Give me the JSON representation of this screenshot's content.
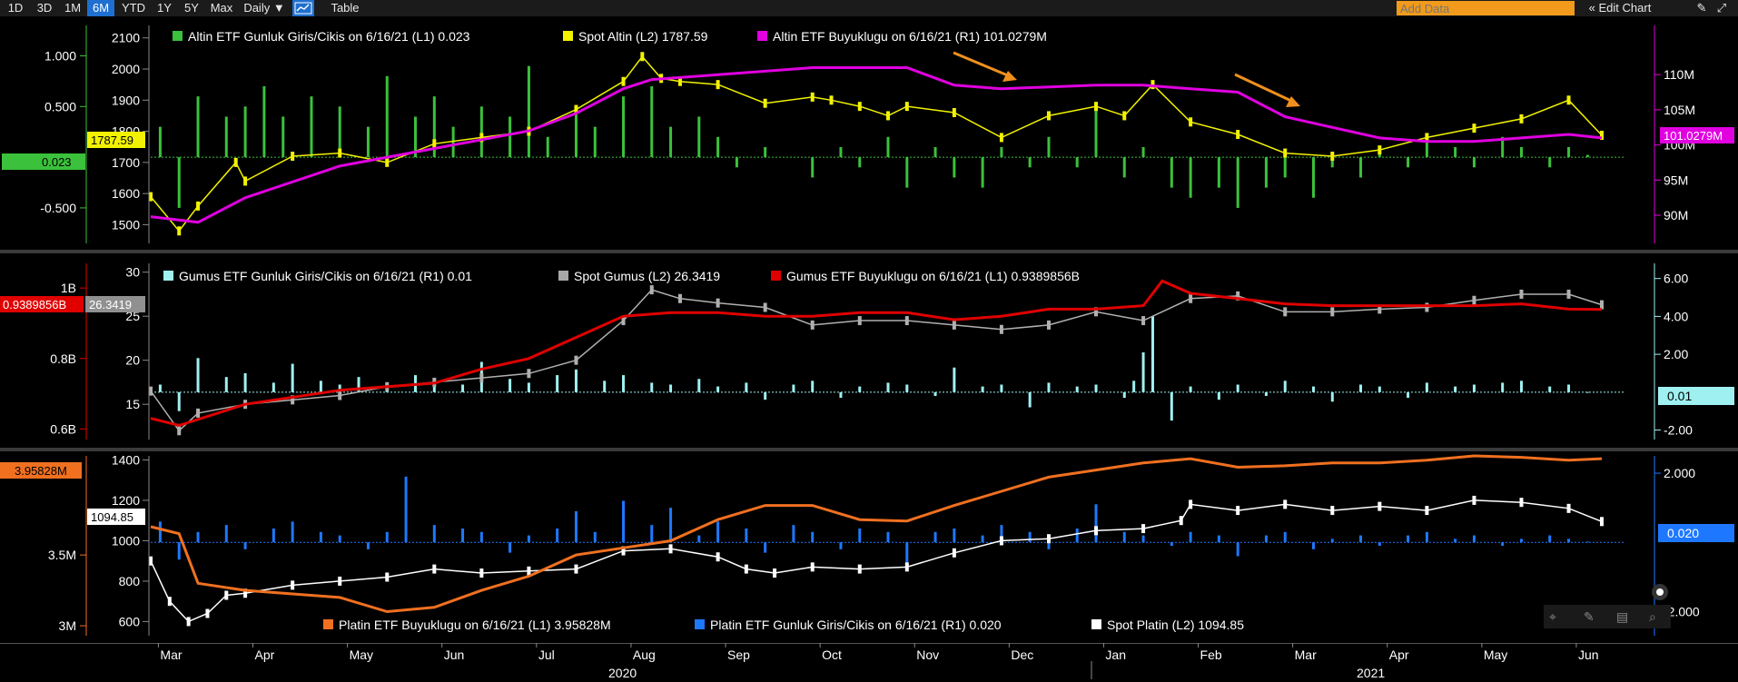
{
  "toolbar": {
    "ranges": [
      "1D",
      "3D",
      "1M",
      "6M",
      "YTD",
      "1Y",
      "5Y",
      "Max"
    ],
    "active_range": "6M",
    "frequency": "Daily ▼",
    "table_label": "Table",
    "add_data_placeholder": "Add Data",
    "edit_chart_label": "« Edit Chart"
  },
  "colors": {
    "gold_etf_flow": "#3bc13b",
    "gold_spot": "#f2f200",
    "gold_etf_size": "#e000e0",
    "silver_etf_flow": "#9ff0f0",
    "silver_spot": "#b0b0b0",
    "silver_etf_size": "#e00000",
    "plat_etf_size": "#f07020",
    "plat_etf_flow": "#1e78ff",
    "plat_spot": "#ffffff",
    "arrow": "#f0901c"
  },
  "chart_data": [
    {
      "type": "line",
      "panel": "gold",
      "legend": [
        {
          "label": "Altin ETF Gunluk Giris/Cikis on 6/16/21 (L1) 0.023",
          "color": "#3bc13b"
        },
        {
          "label": "Spot Altin (L2) 1787.59",
          "color": "#f2f200"
        },
        {
          "label": "Altin ETF Buyuklugu on 6/16/21 (R1) 101.0279M",
          "color": "#e000e0"
        }
      ],
      "left_axis_outer": {
        "ticks": [
          "1.000",
          "0.500",
          "-0.500"
        ],
        "values": [
          1,
          0.5,
          -0.5
        ],
        "ylim": [
          -0.85,
          1.3
        ]
      },
      "left_axis_inner": {
        "ticks": [
          "2100",
          "2000",
          "1900",
          "1800",
          "1700",
          "1600",
          "1500"
        ],
        "values": [
          2100,
          2000,
          1900,
          1800,
          1700,
          1600,
          1500
        ],
        "ylim": [
          1440,
          2140
        ]
      },
      "right_axis": {
        "ticks": [
          "110M",
          "105M",
          "100M",
          "95M",
          "90M"
        ],
        "values": [
          110,
          105,
          100,
          95,
          90
        ],
        "ylim": [
          86,
          117
        ]
      },
      "last_values": {
        "spot": "1787.59",
        "flow": "0.023",
        "size": "101.0279M"
      },
      "months": [
        "Mar",
        "Apr",
        "May",
        "Jun",
        "Jul",
        "Aug",
        "Sep",
        "Oct",
        "Nov",
        "Dec",
        "Jan",
        "Feb",
        "Mar",
        "Apr",
        "May",
        "Jun"
      ],
      "spot_series": {
        "name": "Spot Altin",
        "x": [
          0,
          0.3,
          0.5,
          0.9,
          1,
          1.5,
          2,
          2.5,
          3,
          3.5,
          4,
          4.5,
          5,
          5.2,
          5.4,
          5.6,
          6,
          6.5,
          7,
          7.2,
          7.5,
          7.8,
          8,
          8.5,
          9,
          9.5,
          10,
          10.3,
          10.6,
          11,
          11.5,
          12,
          12.5,
          13,
          13.5,
          14,
          14.5,
          15,
          15.35
        ],
        "values": [
          1590,
          1480,
          1560,
          1700,
          1640,
          1720,
          1730,
          1700,
          1760,
          1780,
          1800,
          1870,
          1960,
          2040,
          1970,
          1960,
          1950,
          1890,
          1910,
          1900,
          1880,
          1850,
          1880,
          1860,
          1780,
          1850,
          1880,
          1850,
          1950,
          1830,
          1790,
          1730,
          1720,
          1740,
          1780,
          1810,
          1840,
          1900,
          1787
        ]
      },
      "size_series": {
        "name": "Altin ETF Buyuklugu",
        "x": [
          0,
          0.5,
          1,
          2,
          3,
          4,
          4.5,
          5,
          5.3,
          6,
          7,
          7.5,
          8,
          8.5,
          9,
          10,
          10.5,
          11,
          11.5,
          12,
          12.5,
          13,
          13.5,
          14,
          14.5,
          15,
          15.35
        ],
        "values": [
          89.8,
          89.0,
          92.5,
          97.0,
          99.5,
          102.0,
          104.5,
          108.0,
          109.3,
          110.0,
          111.0,
          111.0,
          111.0,
          108.5,
          108.0,
          108.5,
          108.5,
          108.0,
          107.5,
          104.0,
          102.5,
          101.0,
          100.5,
          100.5,
          101.0,
          101.5,
          101.0
        ]
      },
      "flow_series": {
        "name": "Altin ETF Gunluk Giris/Cikis",
        "x": [
          0.1,
          0.3,
          0.5,
          0.8,
          1,
          1.2,
          1.4,
          1.7,
          2,
          2.3,
          2.5,
          2.8,
          3,
          3.2,
          3.5,
          3.8,
          4,
          4.2,
          4.5,
          4.7,
          5,
          5.3,
          5.5,
          5.8,
          6,
          6.2,
          6.5,
          7,
          7.3,
          7.5,
          7.8,
          8,
          8.3,
          8.5,
          8.8,
          9,
          9.3,
          9.5,
          9.8,
          10,
          10.3,
          10.5,
          10.8,
          11,
          11.3,
          11.5,
          11.8,
          12,
          12.3,
          12.5,
          12.8,
          13,
          13.3,
          13.5,
          13.8,
          14,
          14.3,
          14.5,
          14.8,
          15,
          15.2
        ],
        "values": [
          0.3,
          -0.5,
          0.6,
          0.4,
          0.5,
          0.7,
          0.4,
          0.6,
          0.5,
          0.3,
          0.8,
          0.4,
          0.6,
          0.3,
          0.5,
          0.4,
          0.9,
          0.2,
          0.5,
          0.3,
          0.6,
          0.7,
          0.3,
          0.4,
          0.2,
          -0.1,
          0.1,
          -0.2,
          0.1,
          -0.1,
          0.2,
          -0.3,
          0.1,
          -0.2,
          -0.3,
          0.1,
          -0.1,
          0.2,
          -0.1,
          0.5,
          -0.2,
          0.1,
          -0.3,
          -0.4,
          -0.3,
          -0.5,
          -0.3,
          -0.2,
          -0.4,
          -0.1,
          -0.2,
          0.1,
          -0.1,
          0.2,
          0.1,
          -0.1,
          0.2,
          0.1,
          -0.1,
          0.1,
          0.023
        ]
      }
    },
    {
      "type": "line",
      "panel": "silver",
      "legend": [
        {
          "label": "Gumus ETF Gunluk Giris/Cikis on 6/16/21 (R1) 0.01",
          "color": "#9ff0f0"
        },
        {
          "label": "Spot Gumus (L2) 26.3419",
          "color": "#a8a8a8"
        },
        {
          "label": "Gumus ETF Buyuklugu on 6/16/21 (L1) 0.9389856B",
          "color": "#e00000"
        }
      ],
      "left_axis_outer": {
        "ticks": [
          "1B",
          "0.8B",
          "0.6B"
        ],
        "values": [
          1,
          0.8,
          0.6
        ],
        "ylim": [
          0.57,
          1.07
        ]
      },
      "left_axis_inner": {
        "ticks": [
          "30",
          "25",
          "20",
          "15"
        ],
        "values": [
          30,
          25,
          20,
          15
        ],
        "ylim": [
          11,
          31
        ]
      },
      "right_axis": {
        "ticks": [
          "6.00",
          "4.00",
          "2.00",
          "-2.00"
        ],
        "values": [
          6,
          4,
          2,
          -2
        ],
        "ylim": [
          -2.5,
          6.8
        ]
      },
      "last_values": {
        "spot": "26.3419",
        "flow": "0.01",
        "size": "0.9389856B"
      },
      "spot_series": {
        "name": "Spot Gumus",
        "x": [
          0,
          0.3,
          0.5,
          1,
          1.5,
          2,
          2.5,
          3,
          3.5,
          4,
          4.5,
          5,
          5.3,
          5.6,
          6,
          6.5,
          7,
          7.5,
          8,
          8.5,
          9,
          9.5,
          10,
          10.5,
          11,
          11.5,
          12,
          12.5,
          13,
          13.5,
          14,
          14.5,
          15,
          15.35
        ],
        "values": [
          16.5,
          12,
          14,
          15,
          15.5,
          16,
          17,
          17.5,
          18,
          18.5,
          20,
          24.5,
          28,
          27,
          26.5,
          26,
          24,
          24.5,
          24.5,
          24,
          23.5,
          24,
          25.5,
          24.5,
          27,
          27.3,
          25.5,
          25.5,
          25.8,
          26,
          26.8,
          27.5,
          27.5,
          26.3
        ]
      },
      "size_series": {
        "name": "Gumus ETF Buyuklugu",
        "x": [
          0,
          0.3,
          1,
          2,
          3,
          3.5,
          4,
          4.5,
          5,
          5.5,
          6,
          6.5,
          7,
          7.5,
          8,
          8.5,
          9,
          9.5,
          10,
          10.5,
          10.7,
          11,
          11.5,
          12,
          12.5,
          13,
          13.5,
          14,
          14.5,
          15,
          15.35
        ],
        "values": [
          0.63,
          0.61,
          0.67,
          0.71,
          0.73,
          0.77,
          0.8,
          0.86,
          0.92,
          0.93,
          0.93,
          0.92,
          0.92,
          0.93,
          0.93,
          0.91,
          0.92,
          0.94,
          0.94,
          0.95,
          1.02,
          0.985,
          0.97,
          0.955,
          0.95,
          0.95,
          0.95,
          0.95,
          0.955,
          0.94,
          0.939
        ]
      },
      "flow_series": {
        "name": "Gumus ETF Gunluk Giris/Cikis",
        "x": [
          0.1,
          0.3,
          0.5,
          0.8,
          1,
          1.3,
          1.5,
          1.8,
          2,
          2.2,
          2.5,
          2.8,
          3,
          3.3,
          3.5,
          3.8,
          4,
          4.3,
          4.5,
          4.8,
          5,
          5.3,
          5.5,
          5.8,
          6,
          6.3,
          6.5,
          6.8,
          7,
          7.3,
          7.5,
          7.8,
          8,
          8.3,
          8.5,
          8.8,
          9,
          9.3,
          9.5,
          9.8,
          10,
          10.3,
          10.4,
          10.5,
          10.6,
          10.8,
          11,
          11.3,
          11.5,
          11.8,
          12,
          12.3,
          12.5,
          12.8,
          13,
          13.3,
          13.5,
          13.8,
          14,
          14.3,
          14.5,
          14.8,
          15,
          15.2
        ],
        "values": [
          0.4,
          -1.0,
          1.8,
          0.8,
          1.0,
          0.5,
          1.5,
          0.6,
          0.4,
          0.8,
          0.5,
          0.9,
          0.6,
          0.4,
          1.6,
          0.7,
          0.5,
          0.9,
          1.2,
          0.6,
          0.9,
          0.5,
          0.4,
          0.7,
          0.3,
          0.5,
          -0.4,
          0.4,
          0.6,
          -0.3,
          0.3,
          0.5,
          0.4,
          -0.2,
          1.3,
          0.3,
          0.4,
          -0.8,
          0.5,
          0.3,
          0.4,
          -0.3,
          0.6,
          2.1,
          4.0,
          -1.5,
          0.3,
          -0.4,
          0.4,
          -0.2,
          0.6,
          0.3,
          -0.5,
          0.4,
          0.3,
          -0.3,
          0.5,
          0.3,
          0.4,
          0.5,
          0.6,
          0.3,
          0.4,
          0.01
        ]
      }
    },
    {
      "type": "line",
      "panel": "platinum",
      "legend": [
        {
          "label": "Platin ETF Buyuklugu on 6/16/21 (L1) 3.95828M",
          "color": "#f07020"
        },
        {
          "label": "Platin ETF Gunluk Giris/Cikis on 6/16/21 (R1) 0.020",
          "color": "#1e78ff"
        },
        {
          "label": "Spot Platin (L2) 1094.85",
          "color": "#ffffff"
        }
      ],
      "left_axis_outer": {
        "ticks": [
          "3.5M",
          "3M"
        ],
        "values": [
          3.5,
          3
        ],
        "ylim": [
          2.93,
          4.2
        ]
      },
      "left_axis_inner": {
        "ticks": [
          "1400",
          "1200",
          "1000",
          "800",
          "600"
        ],
        "values": [
          1400,
          1200,
          1000,
          800,
          600
        ],
        "ylim": [
          530,
          1420
        ]
      },
      "right_axis": {
        "ticks": [
          "2.000",
          "-2.000"
        ],
        "values": [
          2,
          -2
        ],
        "ylim": [
          -2.7,
          2.5
        ]
      },
      "last_values": {
        "spot": "1094.85",
        "flow": "0.020",
        "size": "3.95828M"
      },
      "spot_series": {
        "name": "Spot Platin",
        "x": [
          0,
          0.2,
          0.4,
          0.6,
          0.8,
          1,
          1.5,
          2,
          2.5,
          3,
          3.5,
          4,
          4.5,
          5,
          5.5,
          6,
          6.3,
          6.6,
          7,
          7.5,
          8,
          8.5,
          9,
          9.5,
          10,
          10.5,
          10.9,
          11,
          11.5,
          12,
          12.5,
          13,
          13.5,
          14,
          14.5,
          15,
          15.35
        ],
        "values": [
          900,
          700,
          600,
          640,
          730,
          740,
          780,
          800,
          820,
          860,
          840,
          850,
          860,
          950,
          960,
          920,
          860,
          840,
          870,
          860,
          870,
          940,
          1000,
          1010,
          1050,
          1060,
          1100,
          1180,
          1150,
          1180,
          1150,
          1170,
          1150,
          1200,
          1190,
          1160,
          1095
        ]
      },
      "size_series": {
        "name": "Platin ETF Buyuklugu",
        "x": [
          0,
          0.3,
          0.5,
          1,
          2,
          2.5,
          3,
          3.5,
          4,
          4.5,
          5,
          5.5,
          6,
          6.5,
          7,
          7.5,
          8,
          8.5,
          9,
          9.5,
          10,
          10.5,
          11,
          11.5,
          12,
          12.5,
          13,
          13.5,
          14,
          14.5,
          15,
          15.35
        ],
        "values": [
          3.7,
          3.65,
          3.3,
          3.25,
          3.2,
          3.1,
          3.13,
          3.25,
          3.35,
          3.5,
          3.55,
          3.6,
          3.75,
          3.85,
          3.85,
          3.75,
          3.74,
          3.85,
          3.95,
          4.05,
          4.1,
          4.15,
          4.18,
          4.12,
          4.13,
          4.15,
          4.15,
          4.17,
          4.2,
          4.19,
          4.17,
          4.18
        ]
      },
      "flow_series": {
        "name": "Platin ETF Gunluk Giris/Cikis",
        "x": [
          0.1,
          0.3,
          0.5,
          0.8,
          1,
          1.3,
          1.5,
          1.8,
          2,
          2.3,
          2.5,
          2.7,
          3,
          3.3,
          3.5,
          3.8,
          4,
          4.3,
          4.5,
          4.7,
          5,
          5.3,
          5.5,
          5.8,
          6,
          6.3,
          6.5,
          6.8,
          7,
          7.3,
          7.5,
          7.8,
          8,
          8.3,
          8.5,
          8.8,
          9,
          9.3,
          9.5,
          9.8,
          10,
          10.3,
          10.5,
          10.8,
          11,
          11.3,
          11.5,
          11.8,
          12,
          12.3,
          12.5,
          12.8,
          13,
          13.3,
          13.5,
          13.8,
          14,
          14.3,
          14.5,
          14.8,
          15,
          15.2
        ],
        "values": [
          0.6,
          -0.5,
          0.3,
          0.5,
          -0.2,
          0.4,
          0.6,
          0.3,
          0.2,
          -0.2,
          0.3,
          1.9,
          0.5,
          0.4,
          0.3,
          -0.3,
          0.2,
          0.4,
          0.9,
          0.3,
          1.2,
          0.5,
          1.0,
          0.2,
          0.6,
          0.4,
          -0.3,
          0.5,
          0.3,
          -0.2,
          0.4,
          0.3,
          -0.6,
          0.3,
          0.4,
          0.2,
          0.5,
          0.3,
          -0.2,
          0.4,
          1.1,
          0.3,
          0.2,
          -0.1,
          0.3,
          0.2,
          -0.4,
          0.2,
          0.3,
          -0.2,
          0.1,
          0.2,
          -0.1,
          0.2,
          0.3,
          0.1,
          0.2,
          -0.1,
          0.1,
          0.2,
          0.1,
          0.02
        ]
      }
    }
  ],
  "x_axis": {
    "months": [
      "Mar",
      "Apr",
      "May",
      "Jun",
      "Jul",
      "Aug",
      "Sep",
      "Oct",
      "Nov",
      "Dec",
      "Jan",
      "Feb",
      "Mar",
      "Apr",
      "May",
      "Jun"
    ],
    "years": [
      "2020",
      "2021"
    ]
  }
}
